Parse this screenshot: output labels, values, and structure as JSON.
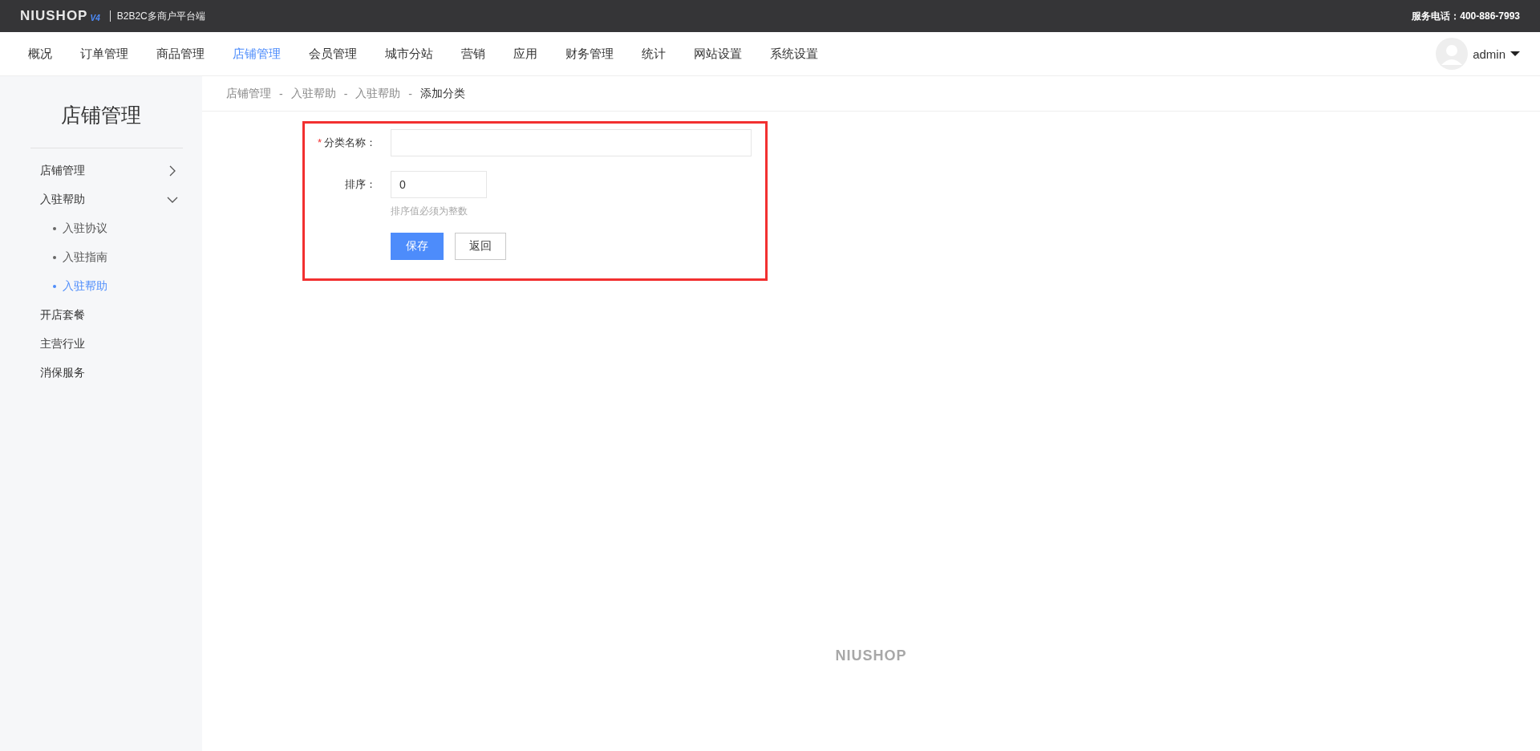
{
  "header": {
    "logo": "NIUSHOP",
    "version": "V4",
    "platform": "B2B2C多商户平台端",
    "service": "服务电话：400-886-7993"
  },
  "nav": [
    {
      "label": "概况",
      "selected": false
    },
    {
      "label": "订单管理",
      "selected": false
    },
    {
      "label": "商品管理",
      "selected": false
    },
    {
      "label": "店铺管理",
      "selected": true
    },
    {
      "label": "会员管理",
      "selected": false
    },
    {
      "label": "城市分站",
      "selected": false
    },
    {
      "label": "营销",
      "selected": false
    },
    {
      "label": "应用",
      "selected": false
    },
    {
      "label": "财务管理",
      "selected": false
    },
    {
      "label": "统计",
      "selected": false
    },
    {
      "label": "网站设置",
      "selected": false
    },
    {
      "label": "系统设置",
      "selected": false
    }
  ],
  "user": {
    "name": "admin"
  },
  "sidebar": {
    "title": "店铺管理",
    "items": [
      {
        "kind": "group",
        "label": "店铺管理",
        "expanded": false
      },
      {
        "kind": "group",
        "label": "入驻帮助",
        "expanded": true,
        "children": [
          {
            "label": "入驻协议",
            "selected": false
          },
          {
            "label": "入驻指南",
            "selected": false
          },
          {
            "label": "入驻帮助",
            "selected": true
          }
        ]
      },
      {
        "kind": "link",
        "label": "开店套餐",
        "selected": false
      },
      {
        "kind": "link",
        "label": "主营行业",
        "selected": false
      },
      {
        "kind": "link",
        "label": "消保服务",
        "selected": false
      }
    ]
  },
  "breadcrumb": [
    {
      "label": "店铺管理"
    },
    {
      "separator": "-",
      "label": "入驻帮助"
    },
    {
      "separator": "-",
      "label": "入驻帮助"
    },
    {
      "separator": "-",
      "label": "添加分类"
    }
  ],
  "form": {
    "highlighted": true,
    "fields": [
      {
        "kind": "wide",
        "label": "分类名称：",
        "required_mark": "*"
      },
      {
        "kind": "short",
        "label": "排序：",
        "value": "0",
        "hint": "排序值必须为整数"
      }
    ],
    "buttons": [
      {
        "kind": "primary",
        "label": "保存"
      },
      {
        "kind": "default",
        "label": "返回"
      }
    ]
  },
  "footer": {
    "logo": "NIUSHOP"
  }
}
